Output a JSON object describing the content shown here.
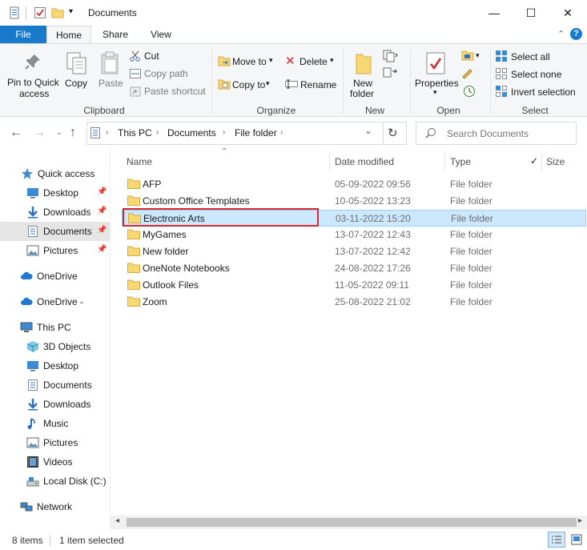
{
  "window": {
    "title": "Documents",
    "minimize": "—",
    "maximize": "☐",
    "close": "✕"
  },
  "ribbon": {
    "tabs": [
      "File",
      "Home",
      "Share",
      "View"
    ],
    "clipboard": {
      "pin_label_1": "Pin to Quick",
      "pin_label_2": "access",
      "copy": "Copy",
      "paste": "Paste",
      "cut": "Cut",
      "copy_path": "Copy path",
      "paste_shortcut": "Paste shortcut",
      "group": "Clipboard"
    },
    "organize": {
      "move_to": "Move to",
      "copy_to": "Copy to",
      "delete": "Delete",
      "rename": "Rename",
      "group": "Organize"
    },
    "new": {
      "new_folder_1": "New",
      "new_folder_2": "folder",
      "group": "New"
    },
    "open": {
      "properties": "Properties",
      "group": "Open"
    },
    "select": {
      "select_all": "Select all",
      "select_none": "Select none",
      "invert": "Invert selection",
      "group": "Select"
    }
  },
  "address": {
    "crumbs": [
      "This PC",
      "Documents",
      "File folder"
    ],
    "search_placeholder": "Search Documents"
  },
  "nav": {
    "quick_access": "Quick access",
    "quick_items": [
      "Desktop",
      "Downloads",
      "Documents",
      "Pictures"
    ],
    "onedrive_1": "OneDrive",
    "onedrive_2": "OneDrive -",
    "this_pc": "This PC",
    "pc_items": [
      "3D Objects",
      "Desktop",
      "Documents",
      "Downloads",
      "Music",
      "Pictures",
      "Videos",
      "Local Disk (C:)"
    ],
    "network": "Network"
  },
  "columns": {
    "name": "Name",
    "date": "Date modified",
    "type": "Type",
    "size": "Size"
  },
  "files": [
    {
      "name": "AFP",
      "date": "05-09-2022 09:56",
      "type": "File folder"
    },
    {
      "name": "Custom Office Templates",
      "date": "10-05-2022 13:23",
      "type": "File folder"
    },
    {
      "name": "Electronic Arts",
      "date": "03-11-2022 15:20",
      "type": "File folder"
    },
    {
      "name": "MyGames",
      "date": "13-07-2022 12:43",
      "type": "File folder"
    },
    {
      "name": "New folder",
      "date": "13-07-2022 12:42",
      "type": "File folder"
    },
    {
      "name": "OneNote Notebooks",
      "date": "24-08-2022 17:26",
      "type": "File folder"
    },
    {
      "name": "Outlook Files",
      "date": "11-05-2022 09:11",
      "type": "File folder"
    },
    {
      "name": "Zoom",
      "date": "25-08-2022 21:02",
      "type": "File folder"
    }
  ],
  "status": {
    "count": "8 items",
    "selected": "1 item selected"
  },
  "colors": {
    "accent": "#1979ca",
    "selection": "#cce8ff",
    "highlight_box": "#d9262b",
    "folder": "#f8d775"
  }
}
